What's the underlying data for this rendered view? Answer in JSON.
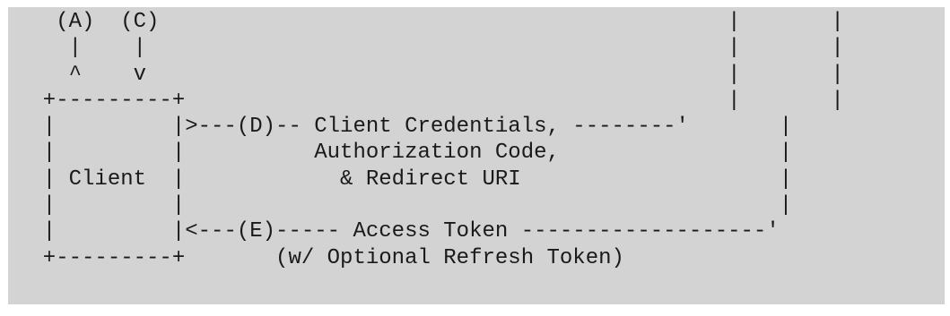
{
  "diagram": {
    "lines": [
      "   (A)  (C)                                            |       |",
      "    |    |                                             |       |",
      "    ^    v                                             |       |",
      "  +---------+                                          |       |",
      "  |         |>---(D)-- Client Credentials, --------'       |",
      "  |         |          Authorization Code,                 |",
      "  | Client  |            & Redirect URI                    |",
      "  |         |                                              |",
      "  |         |<---(E)----- Access Token -------------------'",
      "  +---------+       (w/ Optional Refresh Token)"
    ]
  },
  "colors": {
    "background": "#d3d3d3",
    "text": "#1a1a1a"
  }
}
